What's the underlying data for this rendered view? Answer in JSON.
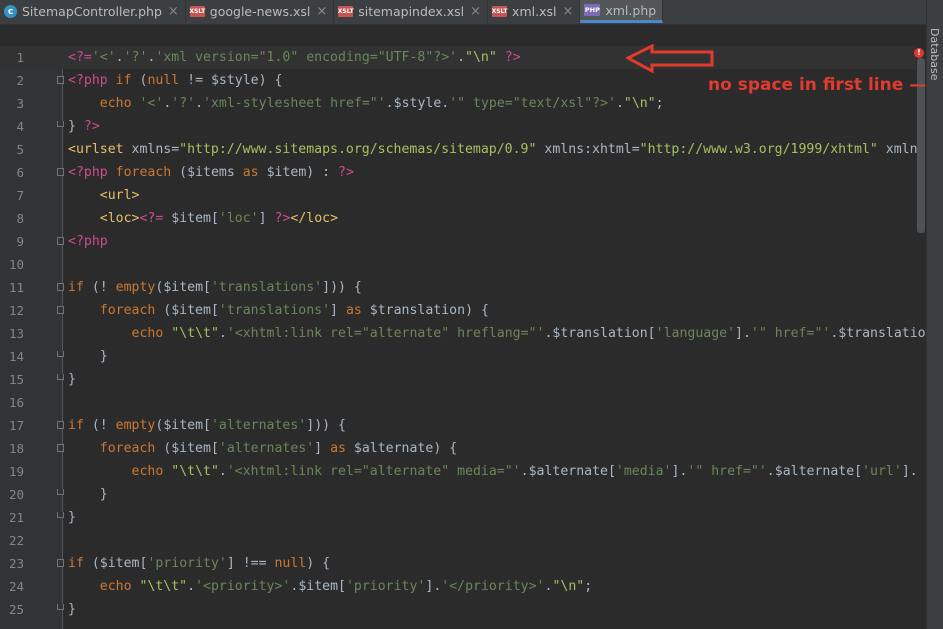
{
  "tabs": [
    {
      "label": "SitemapController.php",
      "icon": "c",
      "icon_text": "c",
      "active": false
    },
    {
      "label": "google-news.xsl",
      "icon": "xslt",
      "icon_text": "XSLT",
      "active": false
    },
    {
      "label": "sitemapindex.xsl",
      "icon": "xslt",
      "icon_text": "XSLT",
      "active": false
    },
    {
      "label": "xml.xsl",
      "icon": "xslt",
      "icon_text": "XSLT",
      "active": false
    },
    {
      "label": "xml.php",
      "icon": "php",
      "icon_text": "PHP",
      "active": true
    }
  ],
  "close_glyph": "×",
  "side_panel": {
    "label": "Database"
  },
  "error_marker": "!",
  "annotation": {
    "text": "no space in first line —",
    "color": "#e23a2f"
  },
  "line_numbers": [
    "1",
    "2",
    "3",
    "4",
    "5",
    "6",
    "7",
    "8",
    "9",
    "10",
    "11",
    "12",
    "13",
    "14",
    "15",
    "16",
    "17",
    "18",
    "19",
    "20",
    "21",
    "22",
    "23",
    "24",
    "25"
  ],
  "code_lines": [
    "<?='<'.'?'.'xml version=\"1.0\" encoding=\"UTF-8\"?>'.\"\\n\" ?>",
    "<?php if (null != $style) {",
    "    echo '<'.'?'.'xml-stylesheet href=\"'.$style.'\" type=\"text/xsl\"?>'.\"\\n\";",
    "} ?>",
    "<urlset xmlns=\"http://www.sitemaps.org/schemas/sitemap/0.9\" xmlns:xhtml=\"http://www.w3.org/1999/xhtml\" xmlns",
    "<?php foreach ($items as $item) : ?>",
    "    <url>",
    "    <loc><?= $item['loc'] ?></loc>",
    "<?php",
    "",
    "if (! empty($item['translations'])) {",
    "    foreach ($item['translations'] as $translation) {",
    "        echo \"\\t\\t\".'<xhtml:link rel=\"alternate\" hreflang=\"'.$translation['language'].'\" href=\"'.$translatio",
    "    }",
    "}",
    "",
    "if (! empty($item['alternates'])) {",
    "    foreach ($item['alternates'] as $alternate) {",
    "        echo \"\\t\\t\".'<xhtml:link rel=\"alternate\" media=\"'.$alternate['media'].'\" href=\"'.$alternate['url'].",
    "    }",
    "}",
    "",
    "if ($item['priority'] !== null) {",
    "    echo \"\\t\\t\".'<priority>'.$item['priority'].'</priority>'.\"\\n\";",
    "}"
  ],
  "colors": {
    "background": "#2b2b2b",
    "keyword": "#cc7832",
    "string": "#6a8759",
    "php_tag": "#d94c6a",
    "xml_tag": "#e8bf6a",
    "annotation": "#e23a2f",
    "active_tab_underline": "#4a88c7"
  }
}
